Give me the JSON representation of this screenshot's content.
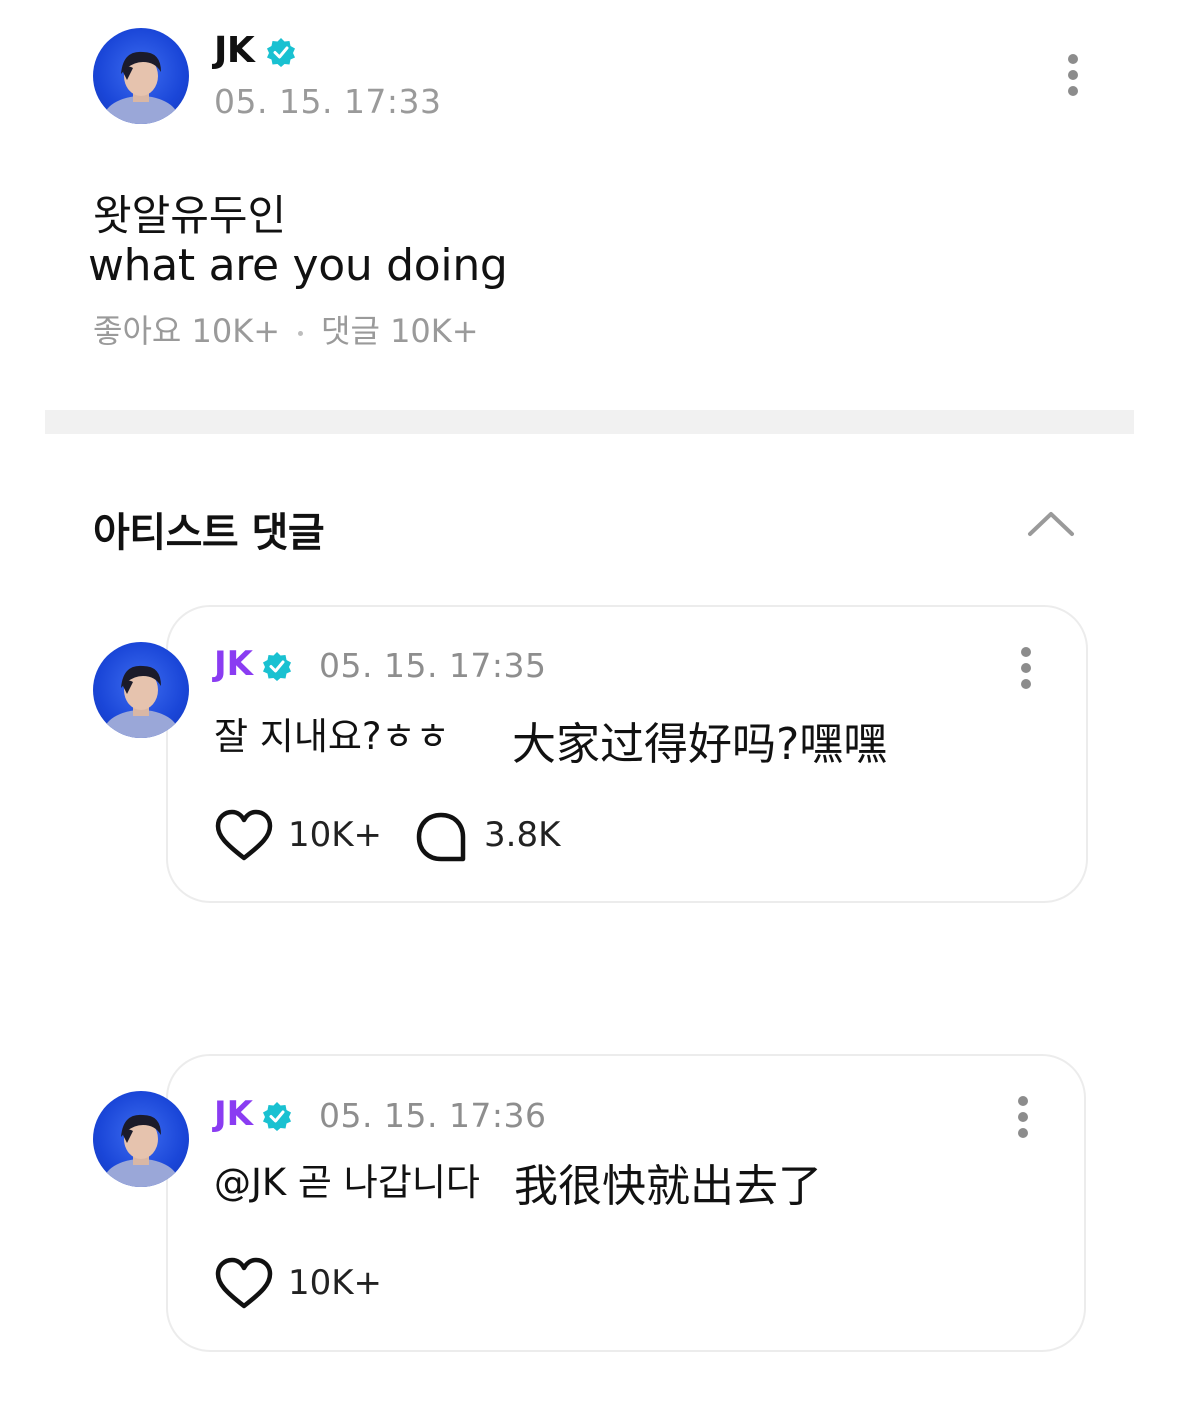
{
  "post": {
    "author": "JK",
    "time": "05. 15. 17:33",
    "text_ko": "왓알유두인",
    "text_en": "what are you doing",
    "likes_label": "좋아요 10K+",
    "comments_label": "댓글 10K+"
  },
  "section": {
    "title": "아티스트 댓글"
  },
  "comments": [
    {
      "author": "JK",
      "time": "05. 15. 17:35",
      "text": "잘 지내요?ㅎㅎ",
      "translation": "大家过得好吗?嘿嘿",
      "likes": "10K+",
      "replies": "3.8K"
    },
    {
      "author": "JK",
      "time": "05. 15. 17:36",
      "text": "@JK 곧 나갑니다",
      "translation": "我很快就出去了",
      "likes": "10K+"
    }
  ],
  "colors": {
    "accent_name": "#8a3cf2",
    "verified": "#19c1d1",
    "avatar_bg": "#1a46d8"
  },
  "icons": {
    "verified": "verified-badge-icon",
    "more": "kebab-menu-icon",
    "collapse": "chevron-up-icon",
    "like": "heart-icon",
    "reply": "speech-bubble-icon"
  }
}
